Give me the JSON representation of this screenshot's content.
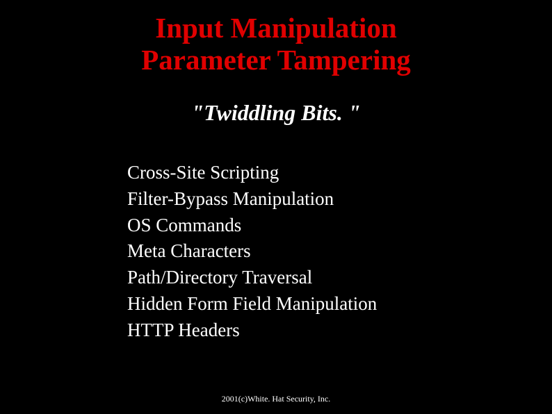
{
  "title": "Input Manipulation\nParameter Tampering",
  "subtitle": "\"Twiddling Bits. \"",
  "items": [
    "Cross-Site Scripting",
    "Filter-Bypass Manipulation",
    "OS Commands",
    "Meta Characters",
    "Path/Directory Traversal",
    "Hidden Form Field Manipulation",
    "HTTP Headers"
  ],
  "footer": "2001(c)White. Hat Security, Inc."
}
